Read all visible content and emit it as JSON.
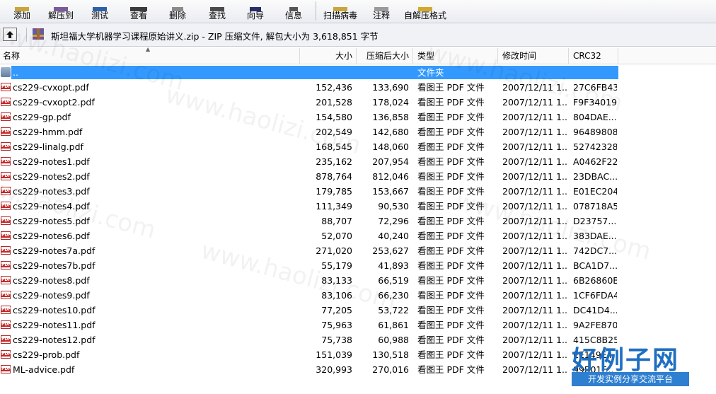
{
  "toolbar": {
    "buttons": [
      {
        "label": "添加",
        "icon": "add-icon"
      },
      {
        "label": "解压到",
        "icon": "extract-icon"
      },
      {
        "label": "测试",
        "icon": "test-icon"
      },
      {
        "label": "查看",
        "icon": "view-icon"
      },
      {
        "label": "删除",
        "icon": "delete-icon"
      },
      {
        "label": "查找",
        "icon": "find-icon"
      },
      {
        "label": "向导",
        "icon": "wizard-icon"
      },
      {
        "label": "信息",
        "icon": "info-icon"
      },
      {
        "label": "扫描病毒",
        "icon": "virus-scan-icon"
      },
      {
        "label": "注释",
        "icon": "comment-icon"
      },
      {
        "label": "自解压格式",
        "icon": "sfx-icon"
      }
    ]
  },
  "address": {
    "text": "斯坦福大学机器学习课程原始讲义.zip - ZIP 压缩文件, 解包大小为 3,618,851 字节"
  },
  "columns": {
    "name": "名称",
    "size": "大小",
    "packed": "压缩后大小",
    "type": "类型",
    "modified": "修改时间",
    "crc": "CRC32"
  },
  "rows": [
    {
      "name": "..",
      "size": "",
      "packed": "",
      "type": "文件夹",
      "modified": "",
      "crc": "",
      "icon": "folder-icon",
      "selected": true
    },
    {
      "name": "cs229-cvxopt.pdf",
      "size": "152,436",
      "packed": "133,690",
      "type": "看图王 PDF 文件",
      "modified": "2007/12/11 1...",
      "crc": "27C6FB43",
      "icon": "pdf-icon"
    },
    {
      "name": "cs229-cvxopt2.pdf",
      "size": "201,528",
      "packed": "178,024",
      "type": "看图王 PDF 文件",
      "modified": "2007/12/11 1...",
      "crc": "F9F34019",
      "icon": "pdf-icon"
    },
    {
      "name": "cs229-gp.pdf",
      "size": "154,580",
      "packed": "136,858",
      "type": "看图王 PDF 文件",
      "modified": "2007/12/11 1...",
      "crc": "804DAE...",
      "icon": "pdf-icon"
    },
    {
      "name": "cs229-hmm.pdf",
      "size": "202,549",
      "packed": "142,680",
      "type": "看图王 PDF 文件",
      "modified": "2007/12/11 1...",
      "crc": "96489808",
      "icon": "pdf-icon"
    },
    {
      "name": "cs229-linalg.pdf",
      "size": "168,545",
      "packed": "148,060",
      "type": "看图王 PDF 文件",
      "modified": "2007/12/11 1...",
      "crc": "52742328",
      "icon": "pdf-icon"
    },
    {
      "name": "cs229-notes1.pdf",
      "size": "235,162",
      "packed": "207,954",
      "type": "看图王 PDF 文件",
      "modified": "2007/12/11 1...",
      "crc": "A0462F22",
      "icon": "pdf-icon"
    },
    {
      "name": "cs229-notes2.pdf",
      "size": "878,764",
      "packed": "812,046",
      "type": "看图王 PDF 文件",
      "modified": "2007/12/11 1...",
      "crc": "23DBAC...",
      "icon": "pdf-icon"
    },
    {
      "name": "cs229-notes3.pdf",
      "size": "179,785",
      "packed": "153,667",
      "type": "看图王 PDF 文件",
      "modified": "2007/12/11 1...",
      "crc": "E01EC204",
      "icon": "pdf-icon"
    },
    {
      "name": "cs229-notes4.pdf",
      "size": "111,349",
      "packed": "90,530",
      "type": "看图王 PDF 文件",
      "modified": "2007/12/11 1...",
      "crc": "078718A5",
      "icon": "pdf-icon"
    },
    {
      "name": "cs229-notes5.pdf",
      "size": "88,707",
      "packed": "72,296",
      "type": "看图王 PDF 文件",
      "modified": "2007/12/11 1...",
      "crc": "D23757...",
      "icon": "pdf-icon"
    },
    {
      "name": "cs229-notes6.pdf",
      "size": "52,070",
      "packed": "40,240",
      "type": "看图王 PDF 文件",
      "modified": "2007/12/11 1...",
      "crc": "383DAE...",
      "icon": "pdf-icon"
    },
    {
      "name": "cs229-notes7a.pdf",
      "size": "271,020",
      "packed": "253,627",
      "type": "看图王 PDF 文件",
      "modified": "2007/12/11 1...",
      "crc": "742DC7...",
      "icon": "pdf-icon"
    },
    {
      "name": "cs229-notes7b.pdf",
      "size": "55,179",
      "packed": "41,893",
      "type": "看图王 PDF 文件",
      "modified": "2007/12/11 1...",
      "crc": "BCA1D7...",
      "icon": "pdf-icon"
    },
    {
      "name": "cs229-notes8.pdf",
      "size": "83,133",
      "packed": "66,519",
      "type": "看图王 PDF 文件",
      "modified": "2007/12/11 1...",
      "crc": "6B26860B",
      "icon": "pdf-icon"
    },
    {
      "name": "cs229-notes9.pdf",
      "size": "83,106",
      "packed": "66,230",
      "type": "看图王 PDF 文件",
      "modified": "2007/12/11 1...",
      "crc": "1CF6FDA4",
      "icon": "pdf-icon"
    },
    {
      "name": "cs229-notes10.pdf",
      "size": "77,205",
      "packed": "53,722",
      "type": "看图王 PDF 文件",
      "modified": "2007/12/11 1...",
      "crc": "DC41D4...",
      "icon": "pdf-icon"
    },
    {
      "name": "cs229-notes11.pdf",
      "size": "75,963",
      "packed": "61,861",
      "type": "看图王 PDF 文件",
      "modified": "2007/12/11 1...",
      "crc": "9A2FE870",
      "icon": "pdf-icon"
    },
    {
      "name": "cs229-notes12.pdf",
      "size": "75,738",
      "packed": "60,988",
      "type": "看图王 PDF 文件",
      "modified": "2007/12/11 1...",
      "crc": "415C8B25",
      "icon": "pdf-icon"
    },
    {
      "name": "cs229-prob.pdf",
      "size": "151,039",
      "packed": "130,518",
      "type": "看图王 PDF 文件",
      "modified": "2007/12/11 1...",
      "crc": "EE149E4...",
      "icon": "pdf-icon"
    },
    {
      "name": "ML-advice.pdf",
      "size": "320,993",
      "packed": "270,016",
      "type": "看图王 PDF 文件",
      "modified": "2007/12/11 1...",
      "crc": "99B01F...",
      "icon": "pdf-icon"
    }
  ],
  "watermark": {
    "text": "www.haolizi.com",
    "brand_big": "好例子网",
    "brand_small": "开发实例分享交流平台"
  },
  "colors": {
    "selection": "#3399ff",
    "pdf_red": "#c62828"
  }
}
